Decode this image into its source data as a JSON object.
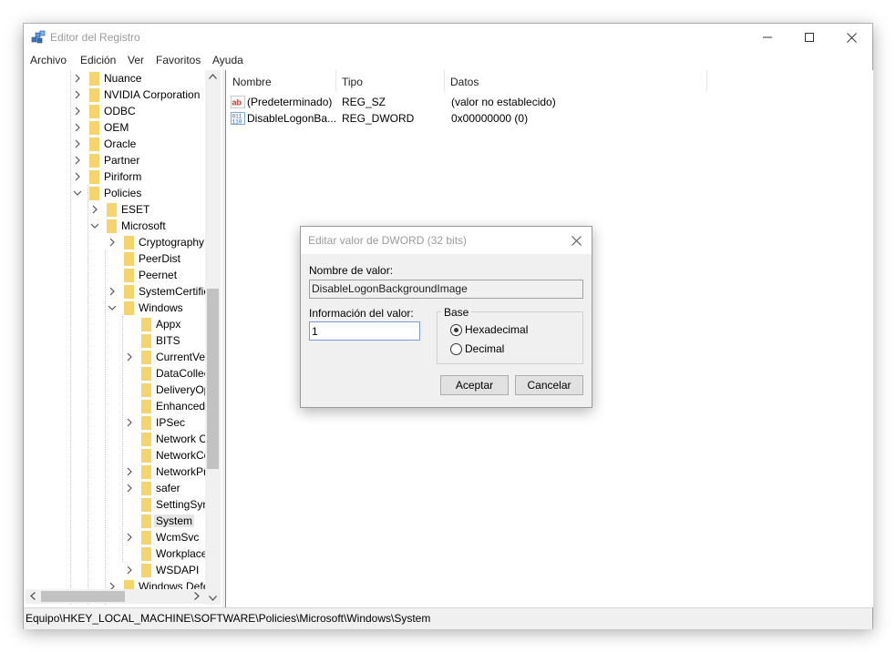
{
  "window": {
    "title": "Editor del Registro"
  },
  "menu": [
    "Archivo",
    "Edición",
    "Ver",
    "Favoritos",
    "Ayuda"
  ],
  "tree": [
    {
      "label": "Nuance",
      "depth": 0,
      "chevron": "right"
    },
    {
      "label": "NVIDIA Corporation",
      "depth": 0,
      "chevron": "right"
    },
    {
      "label": "ODBC",
      "depth": 0,
      "chevron": "right"
    },
    {
      "label": "OEM",
      "depth": 0,
      "chevron": "right"
    },
    {
      "label": "Oracle",
      "depth": 0,
      "chevron": "right"
    },
    {
      "label": "Partner",
      "depth": 0,
      "chevron": "right"
    },
    {
      "label": "Piriform",
      "depth": 0,
      "chevron": "right"
    },
    {
      "label": "Policies",
      "depth": 0,
      "chevron": "down"
    },
    {
      "label": "ESET",
      "depth": 1,
      "chevron": "right"
    },
    {
      "label": "Microsoft",
      "depth": 1,
      "chevron": "down"
    },
    {
      "label": "Cryptography",
      "depth": 2,
      "chevron": "right"
    },
    {
      "label": "PeerDist",
      "depth": 2,
      "chevron": "none"
    },
    {
      "label": "Peernet",
      "depth": 2,
      "chevron": "none"
    },
    {
      "label": "SystemCertificates",
      "depth": 2,
      "chevron": "right"
    },
    {
      "label": "Windows",
      "depth": 2,
      "chevron": "down"
    },
    {
      "label": "Appx",
      "depth": 3,
      "chevron": "none"
    },
    {
      "label": "BITS",
      "depth": 3,
      "chevron": "none"
    },
    {
      "label": "CurrentVersion",
      "depth": 3,
      "chevron": "right"
    },
    {
      "label": "DataCollection",
      "depth": 3,
      "chevron": "none"
    },
    {
      "label": "DeliveryOptimization",
      "depth": 3,
      "chevron": "none"
    },
    {
      "label": "EnhancedStorageDevices",
      "depth": 3,
      "chevron": "none"
    },
    {
      "label": "IPSec",
      "depth": 3,
      "chevron": "right"
    },
    {
      "label": "Network Connections",
      "depth": 3,
      "chevron": "none"
    },
    {
      "label": "NetworkConnectivityStatusIndicator",
      "depth": 3,
      "chevron": "none"
    },
    {
      "label": "NetworkProvider",
      "depth": 3,
      "chevron": "right"
    },
    {
      "label": "safer",
      "depth": 3,
      "chevron": "right"
    },
    {
      "label": "SettingSync",
      "depth": 3,
      "chevron": "none"
    },
    {
      "label": "System",
      "depth": 3,
      "chevron": "none",
      "selected": true
    },
    {
      "label": "WcmSvc",
      "depth": 3,
      "chevron": "right"
    },
    {
      "label": "WorkplaceJoin",
      "depth": 3,
      "chevron": "none"
    },
    {
      "label": "WSDAPI",
      "depth": 3,
      "chevron": "right"
    },
    {
      "label": "Windows Defender",
      "depth": 2,
      "chevron": "right"
    }
  ],
  "columns": {
    "name": "Nombre",
    "type": "Tipo",
    "data": "Datos"
  },
  "values": [
    {
      "icon": "string-value-icon",
      "name": "(Predeterminado)",
      "type": "REG_SZ",
      "data": "(valor no establecido)"
    },
    {
      "icon": "binary-value-icon",
      "name": "DisableLogonBa...",
      "type": "REG_DWORD",
      "data": "0x00000000 (0)"
    }
  ],
  "status": {
    "path": "Equipo\\HKEY_LOCAL_MACHINE\\SOFTWARE\\Policies\\Microsoft\\Windows\\System"
  },
  "dialog": {
    "title": "Editar valor de DWORD (32 bits)",
    "value_name_label": "Nombre de valor:",
    "value_name": "DisableLogonBackgroundImage",
    "value_data_label": "Información del valor:",
    "value_data": "1",
    "base_label": "Base",
    "base_options": [
      {
        "label": "Hexadecimal",
        "checked": true
      },
      {
        "label": "Decimal",
        "checked": false
      }
    ],
    "ok_label": "Aceptar",
    "cancel_label": "Cancelar"
  },
  "colors": {
    "folder": "#f5d46e",
    "selection": "#e5e5e5",
    "window_border": "#aaaaaa"
  }
}
